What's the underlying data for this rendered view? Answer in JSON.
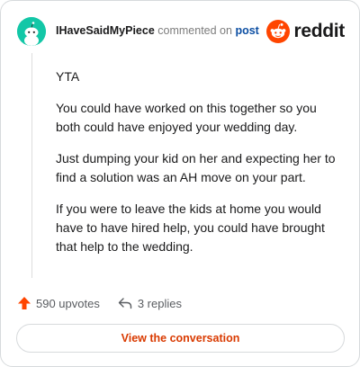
{
  "header": {
    "username": "IHaveSaidMyPiece",
    "action": "commented on",
    "post_link": "post",
    "brand": "reddit"
  },
  "comment": {
    "paragraphs": [
      "YTA",
      "You could have worked on this together so you both could have enjoyed your wedding day.",
      "Just dumping your kid on her and expecting her to find a solution was an AH move on your part.",
      "If you were to leave the kids at home you would have to have hired help, you could have brought that help to the wedding."
    ]
  },
  "footer": {
    "upvotes": "590 upvotes",
    "replies": "3 replies"
  },
  "cta": {
    "label": "View the conversation"
  },
  "colors": {
    "brand": "#ff4500",
    "avatar_bg": "#13c7a7",
    "link": "#0d4fa3",
    "cta_text": "#d93a00"
  },
  "icons": [
    "snoo-avatar-icon",
    "reddit-logo-icon",
    "upvote-arrow-icon",
    "reply-arrow-icon"
  ]
}
